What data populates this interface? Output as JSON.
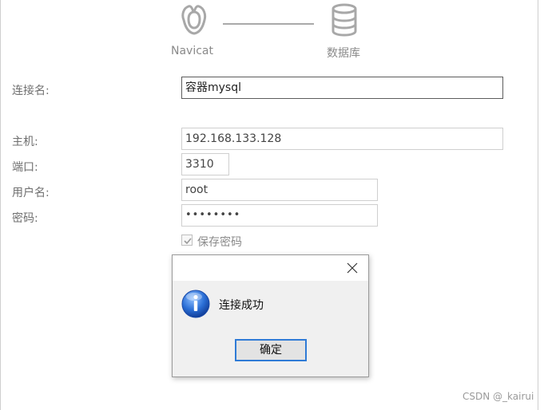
{
  "flow": {
    "steps": [
      {
        "label": "Navicat",
        "icon": "navicat-logo-icon"
      },
      {
        "label": "数据库",
        "icon": "database-icon"
      }
    ]
  },
  "form": {
    "connection_name": {
      "label": "连接名:",
      "value": "容器mysql"
    },
    "host": {
      "label": "主机:",
      "value": "192.168.133.128"
    },
    "port": {
      "label": "端口:",
      "value": "3310"
    },
    "username": {
      "label": "用户名:",
      "value": "root"
    },
    "password": {
      "label": "密码:",
      "value": "••••••••"
    },
    "save_password": {
      "label": "保存密码",
      "checked": true
    }
  },
  "dialog": {
    "close_icon": "close-icon",
    "icon": "info-icon",
    "message": "连接成功",
    "ok_label": "确定",
    "accent_color": "#2f7bd6"
  },
  "watermark": "CSDN @_kairui"
}
